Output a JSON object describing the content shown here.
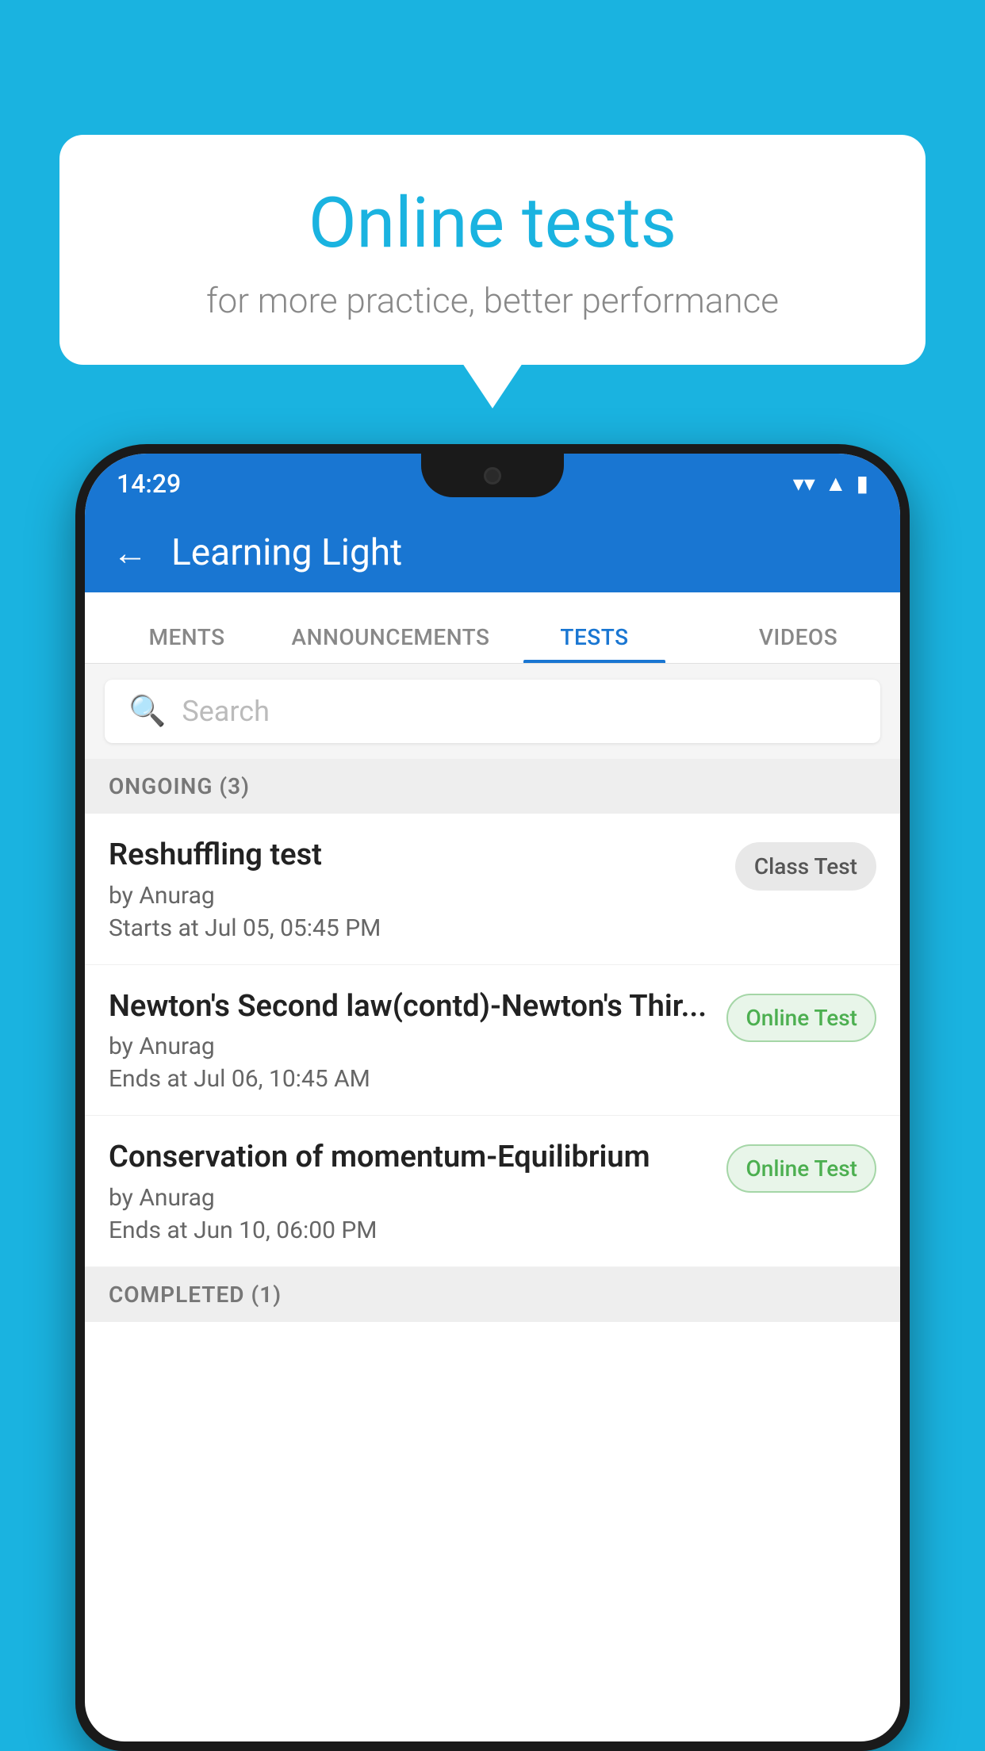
{
  "background": {
    "color": "#1ab3e0"
  },
  "speech_bubble": {
    "title": "Online tests",
    "subtitle": "for more practice, better performance"
  },
  "phone": {
    "status_bar": {
      "time": "14:29",
      "icons": [
        "wifi",
        "signal",
        "battery"
      ]
    },
    "app_header": {
      "back_label": "←",
      "title": "Learning Light"
    },
    "tabs": [
      {
        "label": "MENTS",
        "active": false
      },
      {
        "label": "ANNOUNCEMENTS",
        "active": false
      },
      {
        "label": "TESTS",
        "active": true
      },
      {
        "label": "VIDEOS",
        "active": false
      }
    ],
    "search": {
      "placeholder": "Search"
    },
    "sections": [
      {
        "header": "ONGOING (3)",
        "tests": [
          {
            "name": "Reshuffling test",
            "by": "by Anurag",
            "time_label": "Starts at",
            "time": "Jul 05, 05:45 PM",
            "badge": "Class Test",
            "badge_type": "class"
          },
          {
            "name": "Newton's Second law(contd)-Newton's Thir...",
            "by": "by Anurag",
            "time_label": "Ends at",
            "time": "Jul 06, 10:45 AM",
            "badge": "Online Test",
            "badge_type": "online"
          },
          {
            "name": "Conservation of momentum-Equilibrium",
            "by": "by Anurag",
            "time_label": "Ends at",
            "time": "Jun 10, 06:00 PM",
            "badge": "Online Test",
            "badge_type": "online"
          }
        ]
      }
    ],
    "completed_header": "COMPLETED (1)"
  }
}
